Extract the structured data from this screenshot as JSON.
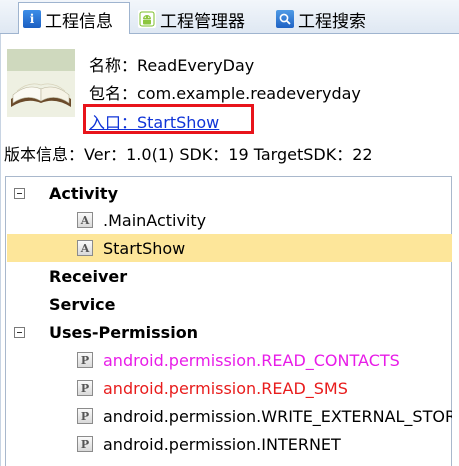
{
  "tabs": [
    {
      "label": "工程信息",
      "icon": "info-icon",
      "active": true
    },
    {
      "label": "工程管理器",
      "icon": "android-icon",
      "active": false
    },
    {
      "label": "工程搜索",
      "icon": "search-icon",
      "active": false
    }
  ],
  "project": {
    "name_line": "名称：ReadEveryDay",
    "package_line": "包名：com.example.readeveryday",
    "entry_line": "入口：StartShow",
    "version_line": "版本信息：Ver：1.0(1) SDK：19 TargetSDK：22"
  },
  "tree": {
    "activity_label": "Activity",
    "activities": [
      ".MainActivity",
      "StartShow"
    ],
    "selected_activity": "StartShow",
    "receiver_label": "Receiver",
    "service_label": "Service",
    "uses_permission_label": "Uses-Permission",
    "permissions": [
      "android.permission.READ_CONTACTS",
      "android.permission.READ_SMS",
      "android.permission.WRITE_EXTERNAL_STORAGE",
      "android.permission.INTERNET"
    ]
  },
  "colors": {
    "highlight_box": "#e8141b",
    "selected_row": "#fde69a",
    "link": "#1034d8",
    "perm_contacts": "#e81ce8",
    "perm_sms": "#e81c1c"
  }
}
